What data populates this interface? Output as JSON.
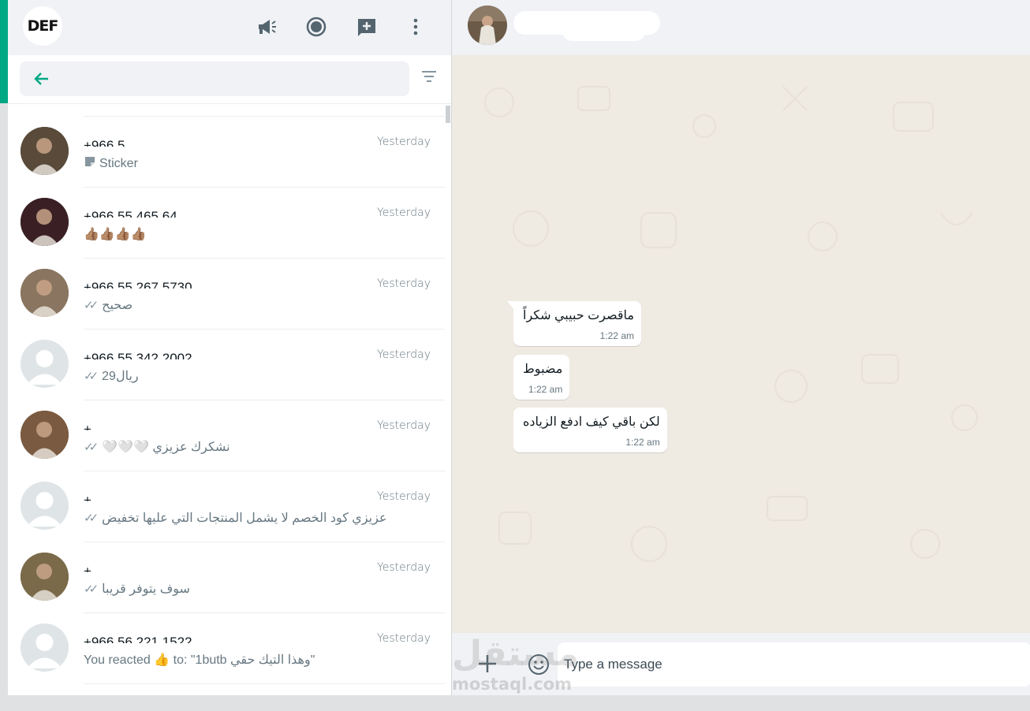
{
  "app": {
    "logo_text": "DEF",
    "accent_color": "#00a884",
    "header_icons": [
      "megaphone-icon",
      "status-icon",
      "new-chat-icon",
      "menu-icon"
    ]
  },
  "search": {
    "placeholder": ""
  },
  "chats": [
    {
      "name": "+966 5",
      "time": "Yesterday",
      "preview": "Sticker",
      "ticks": false,
      "avatar_color": "#5a4a3a",
      "has_photo": true,
      "preview_icon": "sticker-icon"
    },
    {
      "name": "+966 55 465 64",
      "time": "Yesterday",
      "preview": "👍🏽👍🏽👍🏽👍🏽",
      "ticks": false,
      "avatar_color": "#3a2025",
      "has_photo": true
    },
    {
      "name": "+966 55 267 5730",
      "time": "Yesterday",
      "preview": "صحيح",
      "ticks": true,
      "avatar_color": "#8a7560",
      "has_photo": true
    },
    {
      "name": "+966 55 342 2002",
      "time": "Yesterday",
      "preview": "29ريال",
      "ticks": true,
      "avatar_color": "#dfe5e7",
      "has_photo": false
    },
    {
      "name": "+",
      "time": "Yesterday",
      "preview": "🤍🤍🤍 نشكرك عزيزي",
      "ticks": true,
      "avatar_color": "#7a5a40",
      "has_photo": true
    },
    {
      "name": "+",
      "time": "Yesterday",
      "preview": "عزيزي كود الخصم لا يشمل المنتجات التي عليها تخفيض",
      "ticks": true,
      "avatar_color": "#dfe5e7",
      "has_photo": false
    },
    {
      "name": "+",
      "time": "Yesterday",
      "preview": "سوف يتوفر قريبا",
      "ticks": true,
      "avatar_color": "#7a6a4a",
      "has_photo": true
    },
    {
      "name": "+966 56 221 1522",
      "time": "Yesterday",
      "preview": "You reacted 👍 to: \"1butb وهذا التيك حقي\"",
      "ticks": false,
      "avatar_color": "#dfe5e7",
      "has_photo": false
    }
  ],
  "conversation": {
    "messages": [
      {
        "text": "ماقصرت حبيبي شكراً",
        "time": "1:22 am",
        "tail": true
      },
      {
        "text": "مضبوط",
        "time": "1:22 am",
        "tail": false
      },
      {
        "text": "لكن باقي كيف ادفع الزياده",
        "time": "1:22 am",
        "tail": false
      }
    ]
  },
  "composer": {
    "placeholder": "Type a message"
  },
  "watermark": {
    "ar": "مستقل",
    "en": "mostaql.com"
  }
}
